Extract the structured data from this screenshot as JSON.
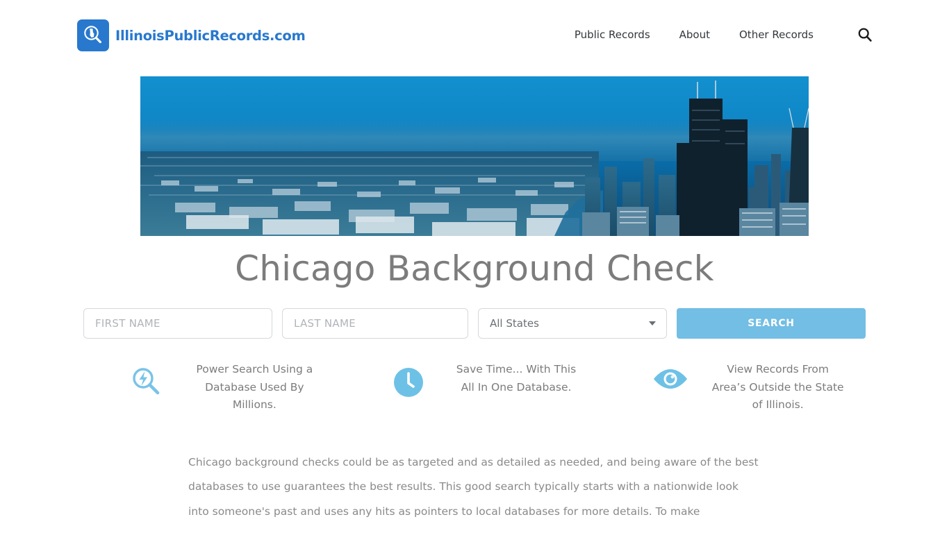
{
  "header": {
    "brand_name": "IllinoisPublicRecords.com",
    "brand_icon": "magnifier-illinois-logo-icon",
    "nav": [
      {
        "label": "Public Records"
      },
      {
        "label": "About"
      },
      {
        "label": "Other Records"
      }
    ],
    "search_icon": "search-icon"
  },
  "hero": {
    "alt": "Aerial view of the Chicago skyline with Willis Tower and John Hancock Center under a clear blue sky"
  },
  "main": {
    "title": "Chicago Background Check"
  },
  "search_form": {
    "first_name": {
      "placeholder": "FIRST NAME",
      "value": ""
    },
    "last_name": {
      "placeholder": "LAST NAME",
      "value": ""
    },
    "state_select": {
      "selected": "All States",
      "options": [
        "All States"
      ]
    },
    "submit_label": "SEARCH",
    "submit_color": "#72bee4"
  },
  "features": [
    {
      "icon": "power-search-icon",
      "text": "Power Search Using a Database Used By Millions."
    },
    {
      "icon": "clock-icon",
      "text": "Save Time... With This All In One Database."
    },
    {
      "icon": "eye-icon",
      "text": "View Records From Area’s Outside the State of Illinois."
    }
  ],
  "content": {
    "paragraph": "Chicago background checks could be as targeted and as detailed as needed, and being aware of the best databases to use guarantees the best results. This good search typically starts with a nationwide look into someone's past and uses any hits as pointers to local databases for more details. To make"
  },
  "colors": {
    "brand_blue": "#2878CE",
    "accent_blue": "#72bee4",
    "title_gray": "#7c7c7c",
    "body_gray": "#8a8a8a"
  }
}
